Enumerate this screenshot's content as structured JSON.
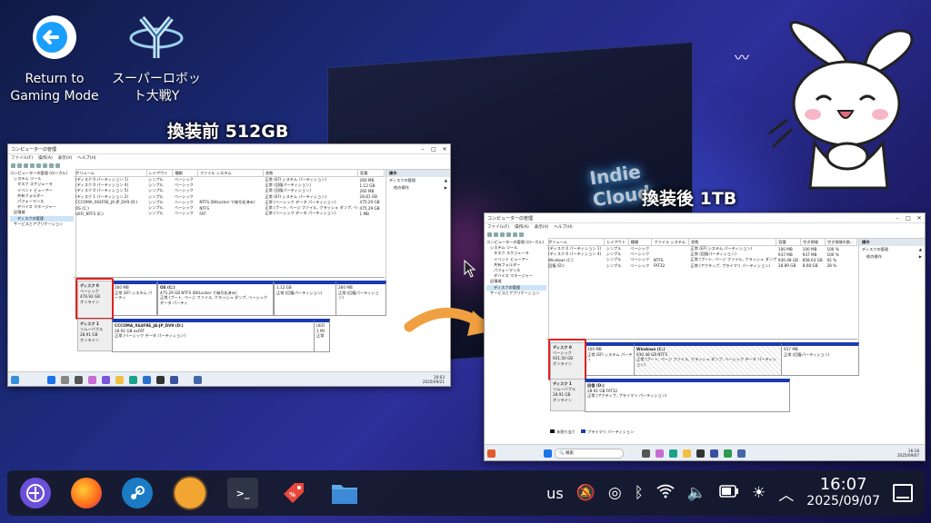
{
  "desktop_icons": [
    {
      "label": "Return to Gaming Mode",
      "icon": "return-arrow-icon"
    },
    {
      "label": "スーパーロボット大戦Y",
      "icon": "game-logo-icon"
    }
  ],
  "headings": {
    "before": "換装前 512GB",
    "after": "換装後 1TB"
  },
  "before": {
    "title": "コンピューターの管理",
    "menu": [
      "ファイル(F)",
      "操作(A)",
      "表示(V)",
      "ヘルプ(H)"
    ],
    "tree": [
      "コンピューターの管理 (ローカル)",
      "システム ツール",
      "タスク スケジューラ",
      "イベント ビューアー",
      "共有フォルダー",
      "パフォーマンス",
      "デバイス マネージャー",
      "記憶域",
      "ディスクの管理",
      "サービスとアプリケーション"
    ],
    "columns": [
      "ボリューム",
      "レイアウト",
      "種類",
      "ファイル システム",
      "状態",
      "容量"
    ],
    "rows": [
      [
        "(ディスク 0 パーティション 1)",
        "シンプル",
        "ベーシック",
        "",
        "正常 (EFI システム パーティション)",
        "260 MB"
      ],
      [
        "(ディスク 0 パーティション 4)",
        "シンプル",
        "ベーシック",
        "",
        "正常 (回復パーティション)",
        "1.12 GB"
      ],
      [
        "(ディスク 0 パーティション 5)",
        "シンプル",
        "ベーシック",
        "",
        "正常 (回復パーティション)",
        "260 MB"
      ],
      [
        "(ディスク 1 パーティション 2)",
        "シンプル",
        "ベーシック",
        "",
        "正常 (EFI システム パーティション)",
        "28.81 GB"
      ],
      [
        "CCCOMA_X64FRE_JA-JP_DV9 (D:)",
        "シンプル",
        "ベーシック",
        "NTFS (BitLocker で暗号化済み)",
        "正常 (ベーシック データ パーティション)",
        "475.29 GB"
      ],
      [
        "OS (C:)",
        "シンプル",
        "ベーシック",
        "NTFS",
        "正常 (ブート, ページ ファイル, クラッシュ ダンプ, ベーシック データ パーティション)",
        "475.29 GB"
      ],
      [
        "UEFI_NTFS (E:)",
        "シンプル",
        "ベーシック",
        "FAT",
        "正常 (ベーシック データ パーティション)",
        "1 MB"
      ]
    ],
    "actions_header": "操作",
    "actions": [
      "ディスクの管理",
      "他の操作"
    ],
    "disk0": {
      "name": "ディスク 0",
      "type": "ベーシック",
      "size": "476.92 GB",
      "status": "オンライン"
    },
    "disk0_parts": [
      {
        "l1": "260 MB",
        "l2": "正常 (EFI システム パーティ"
      },
      {
        "l1": "OS (C:)",
        "l2": "475.29 GB NTFS (BitLocker で暗号化済み)",
        "l3": "正常 (ブート, ページ ファイル, クラッシュ ダンプ, ベーシック データ パーティ"
      },
      {
        "l1": "1.12 GB",
        "l2": "正常 (回復パーティション)"
      },
      {
        "l1": "260 MB",
        "l2": "正常 (回復パーティション)"
      }
    ],
    "disk1": {
      "name": "ディスク 1",
      "type": "リムーバブル",
      "size": "28.91 GB",
      "status": "オンライン"
    },
    "disk1_parts": [
      {
        "l1": "CCCOMA_X64FRE_JA-JP_DV9 (D:)",
        "l2": "28.91 GB exFAT",
        "l3": "正常 (ベーシック データ パーティション)"
      },
      {
        "l1": "UEFI",
        "l2": "1 MI",
        "l3": "正常"
      }
    ],
    "time": "16:03",
    "date": "2025/09/21"
  },
  "after": {
    "title": "コンピューターの管理",
    "menu": [
      "ファイル(F)",
      "操作(A)",
      "表示(V)",
      "ヘルプ(H)"
    ],
    "tree": [
      "コンピューターの管理 (ローカル)",
      "システム ツール",
      "タスク スケジューラ",
      "イベント ビューアー",
      "共有フォルダー",
      "パフォーマンス",
      "デバイス マネージャー",
      "記憶域",
      "ディスクの管理",
      "サービスとアプリケーション"
    ],
    "columns": [
      "ボリューム",
      "レイアウト",
      "種類",
      "ファイル システム",
      "状態",
      "容量",
      "空き領域",
      "空き領域の割..."
    ],
    "rows": [
      [
        "(ディスク 0 パーティション 1)",
        "シンプル",
        "ベーシック",
        "",
        "正常 (EFI システム パーティション)",
        "100 MB",
        "100 MB",
        "100 %"
      ],
      [
        "(ディスク 0 パーティション 4)",
        "シンプル",
        "ベーシック",
        "",
        "正常 (回復パーティション)",
        "937 MB",
        "937 MB",
        "100 %"
      ],
      [
        "Windows (C:)",
        "シンプル",
        "ベーシック",
        "NTFS",
        "正常 (ブート, ページ ファイル, クラッシュ ダンプ, ベーシック データ パーティション)",
        "930.48 GB",
        "858.63 GB",
        "92 %"
      ],
      [
        "回復 (D:)",
        "シンプル",
        "ベーシック",
        "FAT32",
        "正常 (アクティブ, プライマリ パーティション)",
        "28.89 GB",
        "8.08 GB",
        "28 %"
      ]
    ],
    "actions_header": "操作",
    "actions": [
      "ディスクの管理",
      "他の操作"
    ],
    "disk0": {
      "name": "ディスク 0",
      "type": "ベーシック",
      "size": "931.50 GB",
      "status": "オンライン"
    },
    "disk0_parts": [
      {
        "l1": "100 MB",
        "l2": "正常 (EFI システム パーティ"
      },
      {
        "l1": "Windows (C:)",
        "l2": "930.48 GB NTFS",
        "l3": "正常 (ブート, ページ ファイル, クラッシュ ダンプ, ベーシック データ パーティション)"
      },
      {
        "l1": "937 MB",
        "l2": "正常 (回復パーティション)"
      }
    ],
    "disk1": {
      "name": "ディスク 1",
      "type": "リムーバブル",
      "size": "28.91 GB",
      "status": "オンライン"
    },
    "disk1_parts": [
      {
        "l1": "回復 (D:)",
        "l2": "28.91 GB FAT32",
        "l3": "正常 (アクティブ, プライマリ パーティション)"
      }
    ],
    "legend": [
      "未割り当て",
      "プライマリ パーティション"
    ],
    "search": "検索",
    "time": "16:18",
    "date": "2025/09/07"
  },
  "taskbar": {
    "apps": [
      "steam-deck-icon",
      "firefox-icon",
      "steam-icon",
      "game-app-icon",
      "terminal-icon",
      "discount-tag-icon",
      "file-manager-icon"
    ],
    "lang": "us",
    "time": "16:07",
    "date": "2025/09/07"
  },
  "colors": {
    "accent_red": "#e02020",
    "partition_blue": "#1a3bb0",
    "arrow_orange": "#f0a040"
  }
}
